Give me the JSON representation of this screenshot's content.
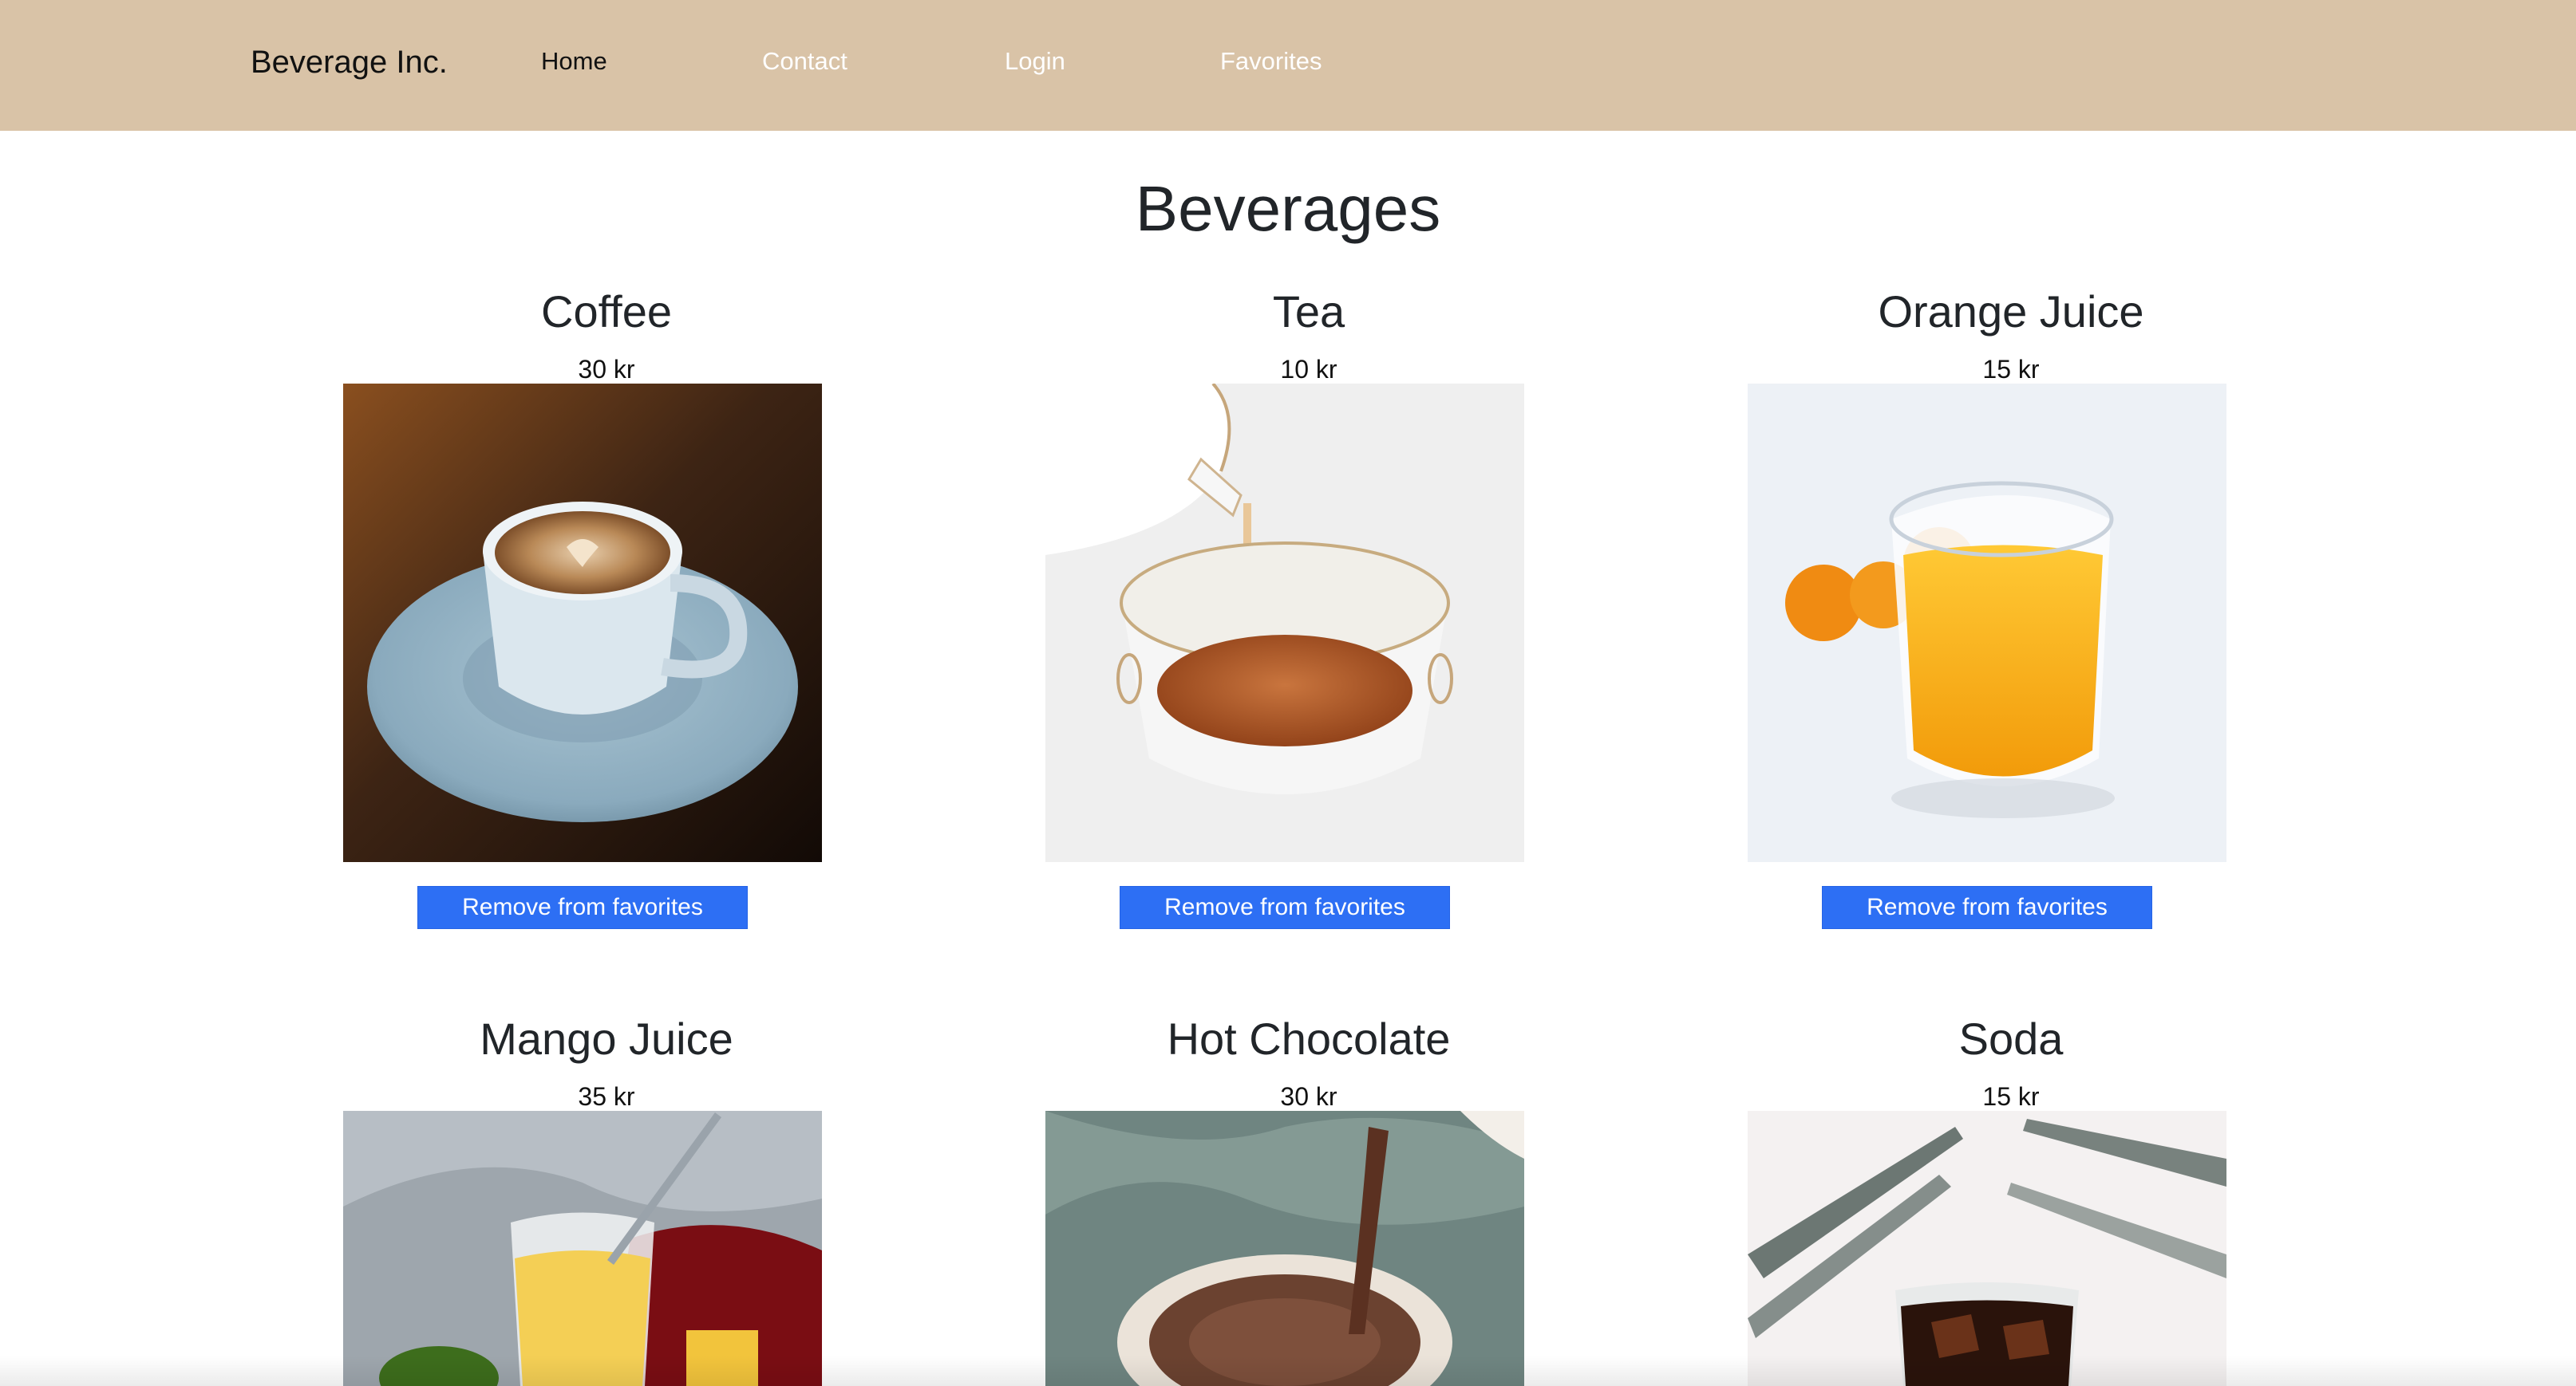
{
  "navbar": {
    "brand": "Beverage Inc.",
    "links": [
      {
        "label": "Home",
        "active": true
      },
      {
        "label": "Contact",
        "active": false
      },
      {
        "label": "Login",
        "active": false
      },
      {
        "label": "Favorites",
        "active": false
      }
    ],
    "background_color": "#d9c3a7"
  },
  "page": {
    "title": "Beverages"
  },
  "products": [
    {
      "name": "Coffee",
      "price": "30 kr",
      "button": "Remove from favorites",
      "image": "coffee-cup-image"
    },
    {
      "name": "Tea",
      "price": "10 kr",
      "button": "Remove from favorites",
      "image": "tea-pouring-image"
    },
    {
      "name": "Orange Juice",
      "price": "15 kr",
      "button": "Remove from favorites",
      "image": "orange-juice-glass-image"
    },
    {
      "name": "Mango Juice",
      "price": "35 kr",
      "button": "",
      "image": "mango-smoothie-image"
    },
    {
      "name": "Hot Chocolate",
      "price": "30 kr",
      "button": "",
      "image": "hot-chocolate-image"
    },
    {
      "name": "Soda",
      "price": "15 kr",
      "button": "",
      "image": "soda-glass-image"
    }
  ],
  "colors": {
    "button": "#2d6ff4",
    "button_text": "#ffffff"
  }
}
